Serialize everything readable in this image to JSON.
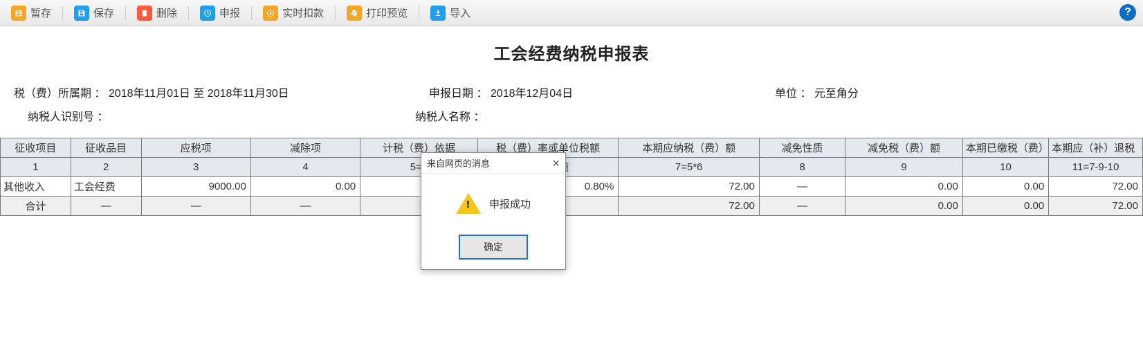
{
  "toolbar": {
    "tempsave": "暂存",
    "save": "保存",
    "delete": "删除",
    "declare": "申报",
    "realtime_deduct": "实时扣款",
    "print_preview": "打印预览",
    "import": "导入",
    "help": "?"
  },
  "page_title": "工会经费纳税申报表",
  "info": {
    "period_label": "税（费）所属期 ：",
    "period_value": "2018年11月01日 至 2018年11月30日",
    "declare_date_label": "申报日期 ：",
    "declare_date_value": "2018年12月04日",
    "unit_label": "单位 ：",
    "unit_value": "元至角分",
    "taxpayer_id_label": "纳税人识别号 ：",
    "taxpayer_id_value": "",
    "taxpayer_name_label": "纳税人名称 ：",
    "taxpayer_name_value": ""
  },
  "table": {
    "headers": [
      "征收项目",
      "征收品目",
      "应税项",
      "减除项",
      "计税（费）依据",
      "税（费）率或单位税额",
      "本期应纳税（费）额",
      "减免性质",
      "减免税（费）额",
      "本期已缴税（费）额",
      "本期应（补）退税（费）额"
    ],
    "subheaders": [
      "1",
      "2",
      "3",
      "4",
      "5=3",
      "单位税额",
      "7=5*6",
      "8",
      "9",
      "10",
      "11=7-9-10"
    ],
    "rows": [
      {
        "c0": "其他收入",
        "c1": "工会经费",
        "c2": "9000.00",
        "c3": "0.00",
        "c4": "",
        "c5": "0.80%",
        "c6": "72.00",
        "c7": "—",
        "c8": "0.00",
        "c9": "0.00",
        "c10": "72.00"
      }
    ],
    "total": {
      "label": "合计",
      "c1": "—",
      "c2": "—",
      "c3": "—",
      "c4": "",
      "c5": "",
      "c6": "72.00",
      "c7": "—",
      "c8": "0.00",
      "c9": "0.00",
      "c10": "72.00"
    }
  },
  "dialog": {
    "title": "来自网页的消息",
    "message": "申报成功",
    "ok": "确定"
  }
}
